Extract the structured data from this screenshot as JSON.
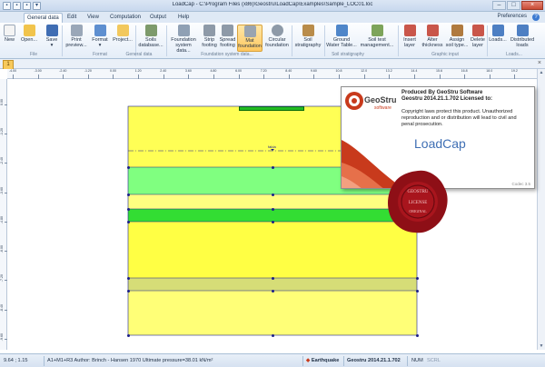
{
  "app": {
    "title": "LoadCap - C:\\Program Files (x86)\\Geostru\\LoadCap\\Examples\\Sample_LOC01.loc",
    "preferences": "Preferences",
    "help": "?"
  },
  "window_controls": {
    "minimize": "–",
    "maximize": "□",
    "close": "×"
  },
  "quick_access": [
    "▪",
    "▪",
    "▪",
    "▾"
  ],
  "tabs": [
    "General data",
    "Edit",
    "View",
    "Computation",
    "Output",
    "Help"
  ],
  "ribbon": {
    "buttons": [
      {
        "label": "New",
        "icon": "new-file-icon",
        "color": "#f4f4f4"
      },
      {
        "label": "Open...",
        "icon": "open-folder-icon",
        "color": "#f1c44c"
      },
      {
        "label": "Save",
        "icon": "save-disk-icon",
        "color": "#3f6db3"
      },
      {
        "label": "Print preview...",
        "icon": "print-preview-icon",
        "color": "#9aa7b8"
      },
      {
        "label": "Project...",
        "icon": "project-icon",
        "color": "#f2c85d"
      },
      {
        "label": "Format",
        "icon": "format-icon",
        "color": "#5e8fd0"
      },
      {
        "label": "Soils database...",
        "icon": "soil-database-icon",
        "color": "#7d9a6b"
      },
      {
        "label": "Foundation system data...",
        "icon": "foundation-data-icon",
        "color": "#8fa0b4"
      },
      {
        "label": "Strip footing",
        "icon": "strip-footing-icon",
        "color": "#8e9aa8"
      },
      {
        "label": "Spread footing",
        "icon": "spread-footing-icon",
        "color": "#8e9aa8"
      },
      {
        "label": "Mat foundation",
        "icon": "mat-foundation-icon",
        "color": "#9aa4b0"
      },
      {
        "label": "Circular foundation",
        "icon": "circular-foundation-icon",
        "color": "#8e9aa8"
      },
      {
        "label": "Soil stratigraphy",
        "icon": "soil-stratigraphy-icon",
        "color": "#b98c4a"
      },
      {
        "label": "Ground Water Table...",
        "icon": "ground-water-icon",
        "color": "#4f86c9"
      },
      {
        "label": "Soil test management...",
        "icon": "soil-test-icon",
        "color": "#7da45a"
      },
      {
        "label": "Insert layer",
        "icon": "insert-layer-icon",
        "color": "#c9564a"
      },
      {
        "label": "Alter thickness",
        "icon": "alter-thickness-icon",
        "color": "#c9564a"
      },
      {
        "label": "Assign soil type...",
        "icon": "assign-soil-icon",
        "color": "#b07a3e"
      },
      {
        "label": "Delete layer",
        "icon": "delete-layer-icon",
        "color": "#c9564a"
      },
      {
        "label": "Loads...",
        "icon": "loads-icon",
        "color": "#4d7fc3"
      },
      {
        "label": "Distributed loads",
        "icon": "distributed-loads-icon",
        "color": "#4d7fc3"
      }
    ],
    "groups": [
      "File",
      "Format",
      "General data",
      "Foundation system data...",
      "Soil stratigraphy",
      "Graphic input",
      "Loads..."
    ]
  },
  "document_tab": {
    "label": "1",
    "close": "×"
  },
  "ruler_top": [
    "-4.00",
    "-3.00",
    "-2.40",
    "-1.20",
    "0.00",
    "1.20",
    "2.40",
    "3.60",
    "4.80",
    "6.00",
    "7.20",
    "8.40",
    "9.60",
    "10.8",
    "12.0",
    "13.2",
    "14.4",
    "15.6",
    "16.8",
    "18.0",
    "19.2"
  ],
  "ruler_left": [
    "0.00",
    "-1.20",
    "-2.40",
    "-3.60",
    "-4.80",
    "-6.00",
    "-7.20",
    "-8.40",
    "-9.60"
  ],
  "drawing": {
    "water_label": "falda"
  },
  "splash": {
    "logo_text": "GeoStru",
    "logo_sub": "software",
    "produced_by": "Produced By GeoStru Software",
    "version_line": "Geostru 2014.21.1.702 Licensed to:",
    "copyright": "Copyright laws protect this product. Unauthorized reproduction and or distribution will lead to civil and penal prosecution.",
    "product": "LoadCap",
    "code": "Codec 3.5"
  },
  "seal": {
    "text_top": "GEOSTRU",
    "text_mid": "LICENSE",
    "text_bottom": "ORIGINAL"
  },
  "status": {
    "coords": "9.64 ; 1.15",
    "info": "A1+M1+R3 Author: Brinch - Hansen 1970 Ultimate pressure=38.01 kN/m²",
    "earthquake": "Earthquake",
    "version": "Geostru 2014.21.1.702",
    "num": "NUM",
    "scrl": "SCRL"
  }
}
